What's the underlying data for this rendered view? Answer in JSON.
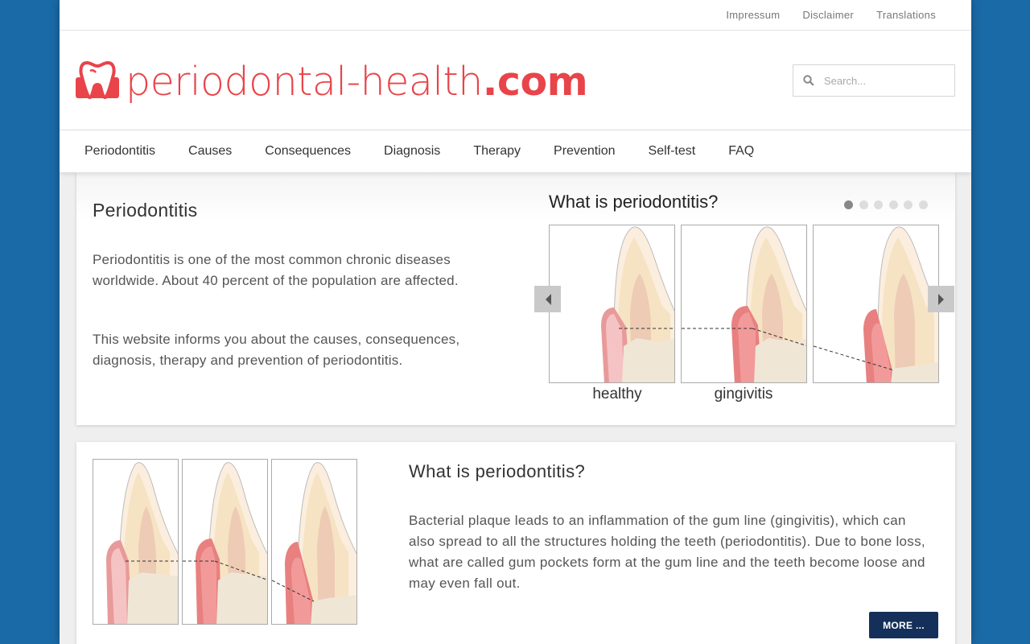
{
  "topbar": {
    "links": [
      "Impressum",
      "Disclaimer",
      "Translations"
    ]
  },
  "logo": {
    "name": "periodontal-health",
    "tld": ".com",
    "brand_color": "#e8444a"
  },
  "search": {
    "placeholder": "Search..."
  },
  "nav": {
    "items": [
      "Periodontitis",
      "Causes",
      "Consequences",
      "Diagnosis",
      "Therapy",
      "Prevention",
      "Self-test",
      "FAQ"
    ]
  },
  "hero": {
    "title": "Periodontitis",
    "paragraph1": "Periodontitis is one of the most common chronic diseases worldwide. About 40 percent of the population are affected.",
    "paragraph2": "This website informs you about the causes, consequences, diagnosis, therapy and prevention of periodontitis.",
    "slider": {
      "title": "What is periodontitis?",
      "dot_count": 6,
      "active_dot": 1,
      "labels": [
        "healthy",
        "gingivitis"
      ]
    }
  },
  "info": {
    "title": "What is periodontitis?",
    "text": "Bacterial plaque leads to an inflammation of the gum line (gingivitis), which can also spread to all the structures holding the teeth (periodontitis). Due to bone loss, what are called gum pockets form at the gum line and the teeth become loose and may even fall out.",
    "button": "MORE ..."
  },
  "colors": {
    "background": "#1a6aa8",
    "button": "#14305a",
    "gum": "#e07878"
  }
}
